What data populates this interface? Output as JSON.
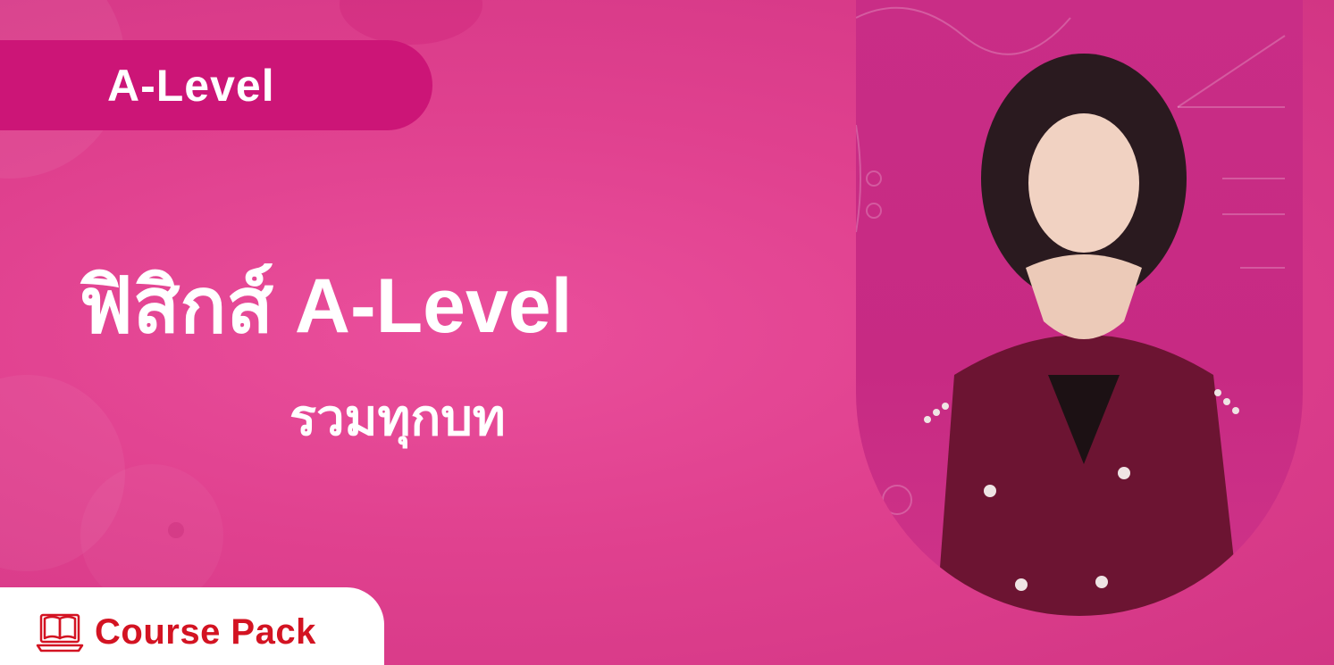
{
  "badge": {
    "level": "A-Level"
  },
  "title": {
    "main": "ฟิสิกส์ A-Level",
    "sub": "รวมทุกบท"
  },
  "course": {
    "label": "Course Pack",
    "icon": "book-laptop-icon"
  },
  "photo": {
    "description_icon": "teacher-photo"
  },
  "colors": {
    "background": "#e0418f",
    "pill": "#cc1577",
    "course_text": "#d31322"
  }
}
